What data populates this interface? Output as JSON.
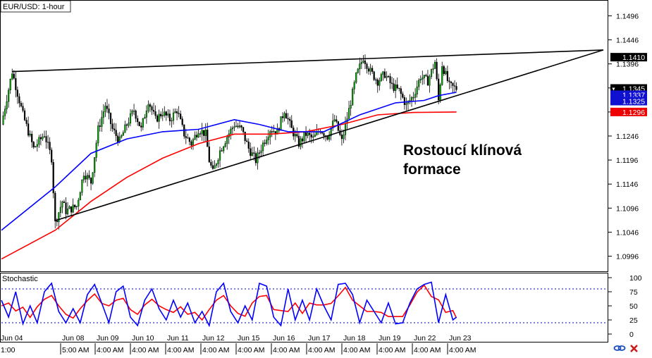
{
  "chart_data": {
    "type": "candlestick",
    "title": "EUR/USD: 1-hour",
    "annotation": "Rostoucí klínová formace",
    "y_axis": {
      "ylim": [
        1.0966,
        1.1526
      ],
      "ticks": [
        "1.1496",
        "1.1446",
        "1.1396",
        "1.1346",
        "1.1296",
        "1.1246",
        "1.1196",
        "1.1146",
        "1.1096",
        "1.1046",
        "1.0996"
      ],
      "scale": "linear"
    },
    "price_tags": [
      {
        "label": "1.1410",
        "value": 1.141,
        "bg": "#000000",
        "fg": "#ffffff"
      },
      {
        "label": "1.1345",
        "value": 1.1345,
        "bg": "#000000",
        "fg": "#ffffff",
        "marker": "▼"
      },
      {
        "label": "1.1337",
        "value": 1.1337,
        "bg": "#1010d0",
        "fg": "#ffffff"
      },
      {
        "label": "1.1325",
        "value": 1.1325,
        "bg": "#1010d0",
        "fg": "#ffffff"
      },
      {
        "label": "1.1296",
        "value": 1.1296,
        "bg": "#ee0000",
        "fg": "#ffffff"
      }
    ],
    "x_axis": {
      "date_labels": [
        "Jun 04",
        "Jun 08",
        "Jun 09",
        "Jun 10",
        "Jun 11",
        "Jun 12",
        "Jun 15",
        "Jun 16",
        "Jun 17",
        "Jun 18",
        "Jun 19",
        "Jun 22",
        "Jun 23"
      ],
      "time_labels": [
        "1:00",
        "5:00 AM",
        "4:00 AM",
        "4:00 AM",
        "4:00 AM",
        "4:00 AM",
        "4:00 AM",
        "4:00 AM",
        "4:00 AM",
        "4:00 AM",
        "4:00 AM",
        "4:00 AM",
        "4:00 AM"
      ]
    },
    "close_path": [
      [
        0,
        1.127
      ],
      [
        3,
        1.138
      ],
      [
        6,
        1.129
      ],
      [
        9,
        1.122
      ],
      [
        12,
        1.125
      ],
      [
        14,
        1.12
      ],
      [
        15,
        1.1065
      ],
      [
        17,
        1.111
      ],
      [
        18,
        1.109
      ],
      [
        21,
        1.11
      ],
      [
        23,
        1.117
      ],
      [
        25,
        1.115
      ],
      [
        27,
        1.126
      ],
      [
        29,
        1.131
      ],
      [
        31,
        1.126
      ],
      [
        33,
        1.1235
      ],
      [
        35,
        1.127
      ],
      [
        37,
        1.13
      ],
      [
        39,
        1.126
      ],
      [
        41,
        1.132
      ],
      [
        43,
        1.128
      ],
      [
        45,
        1.1295
      ],
      [
        47,
        1.128
      ],
      [
        49,
        1.13
      ],
      [
        51,
        1.125
      ],
      [
        53,
        1.123
      ],
      [
        55,
        1.126
      ],
      [
        57,
        1.125
      ],
      [
        58,
        1.1195
      ],
      [
        59,
        1.117
      ],
      [
        61,
        1.1215
      ],
      [
        63,
        1.1245
      ],
      [
        65,
        1.127
      ],
      [
        67,
        1.126
      ],
      [
        69,
        1.122
      ],
      [
        71,
        1.1195
      ],
      [
        73,
        1.123
      ],
      [
        75,
        1.126
      ],
      [
        77,
        1.1255
      ],
      [
        79,
        1.13
      ],
      [
        81,
        1.126
      ],
      [
        83,
        1.123
      ],
      [
        85,
        1.125
      ],
      [
        87,
        1.124
      ],
      [
        89,
        1.126
      ],
      [
        91,
        1.1245
      ],
      [
        93,
        1.128
      ],
      [
        95,
        1.1235
      ],
      [
        97,
        1.13
      ],
      [
        99,
        1.137
      ],
      [
        101,
        1.141
      ],
      [
        103,
        1.138
      ],
      [
        105,
        1.136
      ],
      [
        107,
        1.1375
      ],
      [
        109,
        1.135
      ],
      [
        111,
        1.134
      ],
      [
        113,
        1.131
      ],
      [
        115,
        1.133
      ],
      [
        117,
        1.137
      ],
      [
        119,
        1.136
      ],
      [
        121,
        1.14
      ],
      [
        122,
        1.132
      ],
      [
        123,
        1.1395
      ],
      [
        125,
        1.135
      ],
      [
        127,
        1.1345
      ]
    ],
    "ma_blue": [
      [
        0,
        1.105
      ],
      [
        15,
        1.114
      ],
      [
        25,
        1.121
      ],
      [
        35,
        1.124
      ],
      [
        45,
        1.1255
      ],
      [
        55,
        1.126
      ],
      [
        65,
        1.128
      ],
      [
        72,
        1.127
      ],
      [
        80,
        1.1255
      ],
      [
        90,
        1.1255
      ],
      [
        100,
        1.129
      ],
      [
        110,
        1.1315
      ],
      [
        118,
        1.132
      ],
      [
        122,
        1.133
      ],
      [
        127,
        1.1337
      ]
    ],
    "ma_red": [
      [
        0,
        1.099
      ],
      [
        15,
        1.105
      ],
      [
        25,
        1.111
      ],
      [
        35,
        1.116
      ],
      [
        45,
        1.12
      ],
      [
        55,
        1.123
      ],
      [
        65,
        1.125
      ],
      [
        75,
        1.125
      ],
      [
        85,
        1.1255
      ],
      [
        95,
        1.127
      ],
      [
        105,
        1.129
      ],
      [
        115,
        1.1295
      ],
      [
        127,
        1.1296
      ]
    ],
    "trendlines": [
      {
        "name": "upper",
        "points": [
          [
            3,
            1.138
          ],
          [
            168,
            1.1425
          ]
        ]
      },
      {
        "name": "lower",
        "points": [
          [
            15,
            1.107
          ],
          [
            168,
            1.1425
          ]
        ]
      }
    ],
    "stochastic": {
      "title": "Stochastic",
      "ylim": [
        0,
        100
      ],
      "ticks": [
        "100",
        "75",
        "50",
        "25",
        "0"
      ],
      "levels": [
        80,
        20
      ],
      "k_path": [
        [
          0,
          60
        ],
        [
          2,
          30
        ],
        [
          4,
          75
        ],
        [
          6,
          18
        ],
        [
          8,
          50
        ],
        [
          10,
          20
        ],
        [
          12,
          75
        ],
        [
          14,
          90
        ],
        [
          16,
          40
        ],
        [
          18,
          20
        ],
        [
          20,
          45
        ],
        [
          22,
          20
        ],
        [
          24,
          70
        ],
        [
          26,
          88
        ],
        [
          28,
          55
        ],
        [
          30,
          20
        ],
        [
          32,
          75
        ],
        [
          34,
          85
        ],
        [
          36,
          30
        ],
        [
          38,
          15
        ],
        [
          40,
          60
        ],
        [
          42,
          80
        ],
        [
          44,
          45
        ],
        [
          46,
          25
        ],
        [
          48,
          60
        ],
        [
          50,
          30
        ],
        [
          52,
          55
        ],
        [
          54,
          20
        ],
        [
          56,
          40
        ],
        [
          58,
          15
        ],
        [
          60,
          75
        ],
        [
          62,
          90
        ],
        [
          64,
          40
        ],
        [
          66,
          20
        ],
        [
          68,
          50
        ],
        [
          70,
          25
        ],
        [
          72,
          90
        ],
        [
          74,
          85
        ],
        [
          76,
          30
        ],
        [
          78,
          15
        ],
        [
          80,
          80
        ],
        [
          82,
          25
        ],
        [
          84,
          60
        ],
        [
          86,
          25
        ],
        [
          88,
          80
        ],
        [
          90,
          50
        ],
        [
          92,
          25
        ],
        [
          94,
          88
        ],
        [
          96,
          90
        ],
        [
          98,
          70
        ],
        [
          100,
          20
        ],
        [
          102,
          60
        ],
        [
          104,
          40
        ],
        [
          106,
          20
        ],
        [
          108,
          55
        ],
        [
          110,
          18
        ],
        [
          112,
          20
        ],
        [
          114,
          55
        ],
        [
          116,
          80
        ],
        [
          118,
          88
        ],
        [
          120,
          92
        ],
        [
          122,
          20
        ],
        [
          124,
          70
        ],
        [
          126,
          25
        ],
        [
          127,
          30
        ]
      ]
    },
    "colors": {
      "bull": "#00aa00",
      "bear": "#000000",
      "ma_blue": "#0000ff",
      "ma_red": "#ff0000",
      "stoch_k": "#0000ff",
      "stoch_d": "#ff0000",
      "level_line": "#0000cc"
    }
  }
}
